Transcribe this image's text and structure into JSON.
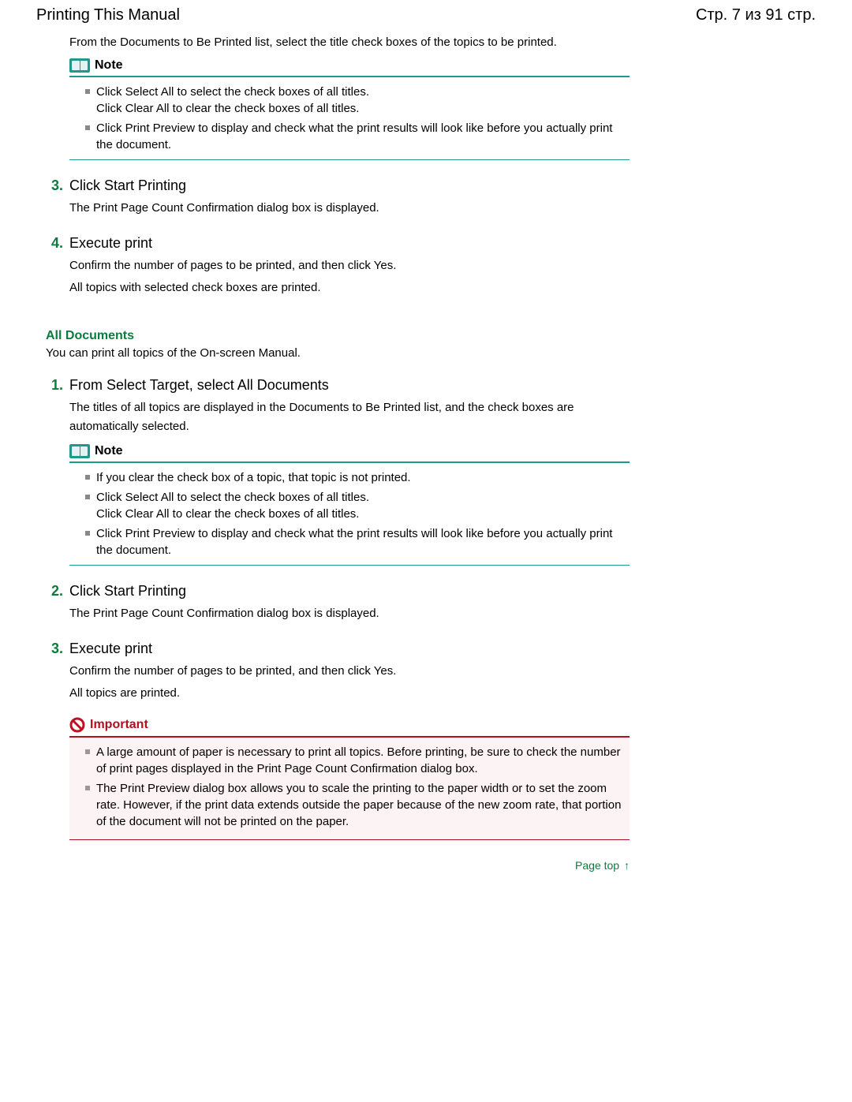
{
  "header": {
    "title": "Printing This Manual",
    "page_indicator": "Стр. 7 из 91 стр."
  },
  "intro": "From the Documents to Be Printed list, select the title check boxes of the topics to be printed.",
  "note1": {
    "label": "Note",
    "items": [
      {
        "line1": "Click Select All to select the check boxes of all titles.",
        "line2": "Click Clear All to clear the check boxes of all titles."
      },
      {
        "line1": "Click Print Preview to display and check what the print results will look like before you actually print the document."
      }
    ]
  },
  "step3": {
    "num": "3.",
    "title": "Click Start Printing",
    "body": "The Print Page Count Confirmation dialog box is displayed."
  },
  "step4": {
    "num": "4.",
    "title": "Execute print",
    "body1": "Confirm the number of pages to be printed, and then click Yes.",
    "body2": "All topics with selected check boxes are printed."
  },
  "section2": {
    "heading": "All Documents",
    "intro": "You can print all topics of the On-screen Manual."
  },
  "s2step1": {
    "num": "1.",
    "title": "From Select Target, select All Documents",
    "body": "The titles of all topics are displayed in the Documents to Be Printed list, and the check boxes are automatically selected."
  },
  "note2": {
    "label": "Note",
    "items": [
      {
        "line1": "If you clear the check box of a topic, that topic is not printed."
      },
      {
        "line1": "Click Select All to select the check boxes of all titles.",
        "line2": "Click Clear All to clear the check boxes of all titles."
      },
      {
        "line1": "Click Print Preview to display and check what the print results will look like before you actually print the document."
      }
    ]
  },
  "s2step2": {
    "num": "2.",
    "title": "Click Start Printing",
    "body": "The Print Page Count Confirmation dialog box is displayed."
  },
  "s2step3": {
    "num": "3.",
    "title": "Execute print",
    "body1": "Confirm the number of pages to be printed, and then click Yes.",
    "body2": "All topics are printed."
  },
  "important": {
    "label": "Important",
    "items": [
      "A large amount of paper is necessary to print all topics. Before printing, be sure to check the number of print pages displayed in the Print Page Count Confirmation dialog box.",
      "The Print Preview dialog box allows you to scale the printing to the paper width or to set the zoom rate. However, if the print data extends outside the paper because of the new zoom rate, that portion of the document will not be printed on the paper."
    ]
  },
  "page_top": {
    "label": "Page top",
    "arrow": "↑"
  }
}
